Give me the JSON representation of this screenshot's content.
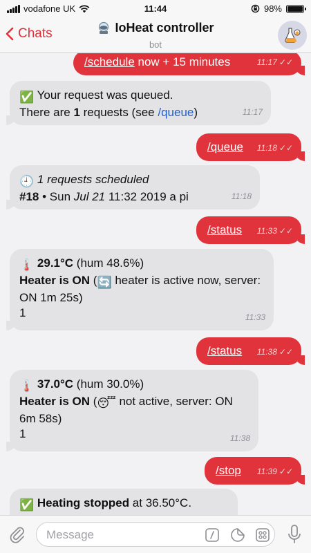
{
  "status_bar": {
    "carrier": "vodafone UK",
    "time": "11:44",
    "battery": "98%",
    "battery_level": 0.98
  },
  "header": {
    "back_label": "Chats",
    "title": "IoHeat controller",
    "subtitle": "bot"
  },
  "messages": [
    {
      "cmd": "/schedule",
      "rest": " now + 15 minutes",
      "time": "11:17"
    },
    {
      "emoji": "✅",
      "line1": "Your request was queued.",
      "line2_a": "There are ",
      "line2_b": "1",
      "line2_c": " requests (see ",
      "link": "/queue",
      "line2_d": ")",
      "time": "11:17"
    },
    {
      "cmd": "/queue",
      "time": "11:18"
    },
    {
      "emoji": "🕘",
      "line1": "1 requests scheduled",
      "line2_a": "#18",
      "line2_b": " • Sun ",
      "line2_c": "Jul 21",
      "line2_d": " 11:32 2019 a pi",
      "time": "11:18"
    },
    {
      "cmd": "/status",
      "time": "11:33"
    },
    {
      "emoji": "🌡️",
      "temp": "29.1°C",
      "hum": " (hum 48.6%)",
      "heater": "Heater is ON",
      "paren_open": " (",
      "state_emoji": "🔄",
      "detail": " heater is active now, server: ON 1m 25s)",
      "count": "1",
      "time": "11:33"
    },
    {
      "cmd": "/status",
      "time": "11:38"
    },
    {
      "emoji": "🌡️",
      "temp": "37.0°C",
      "hum": " (hum 30.0%)",
      "heater": "Heater is ON",
      "paren_open": " (",
      "state_emoji": "😴",
      "detail": " not active, server: ON 6m 58s)",
      "count": "1",
      "time": "11:38"
    },
    {
      "cmd": "/stop",
      "time": "11:39"
    },
    {
      "emoji": "✅",
      "bold": "Heating stopped",
      "rest": " at 36.50°C.",
      "time": ""
    }
  ],
  "input": {
    "placeholder": "Message"
  },
  "colors": {
    "accent": "#e0303a",
    "outgoing": "#e0333c",
    "incoming": "#e3e3e6"
  }
}
